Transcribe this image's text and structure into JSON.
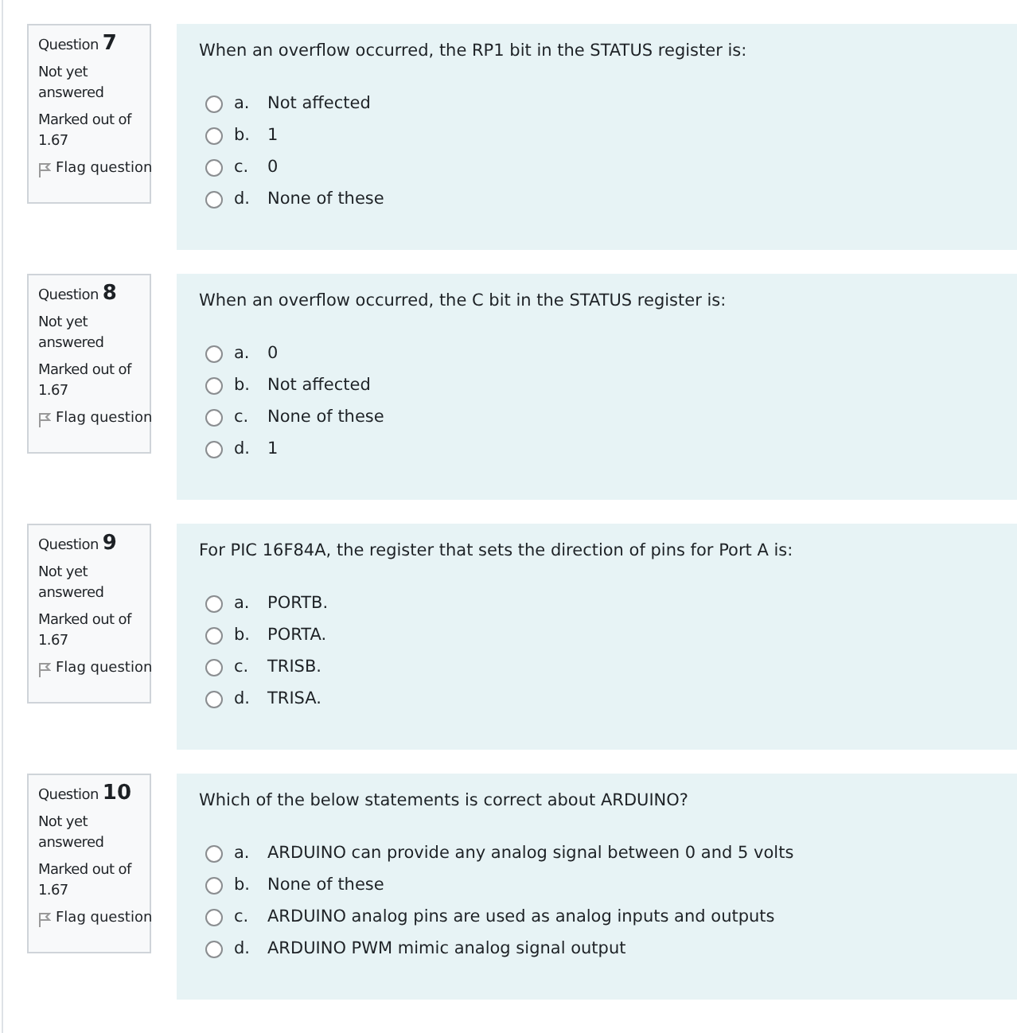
{
  "questions": [
    {
      "label": "Question",
      "number": "7",
      "status": "Not yet answered",
      "marks": "Marked out of 1.67",
      "flag": "Flag question",
      "text": "When an overflow occurred, the RP1 bit in the STATUS register is:",
      "options": [
        {
          "letter": "a.",
          "text": "Not affected",
          "selected": false
        },
        {
          "letter": "b.",
          "text": "1",
          "selected": false
        },
        {
          "letter": "c.",
          "text": "0",
          "selected": false
        },
        {
          "letter": "d.",
          "text": "None of these",
          "selected": false
        }
      ]
    },
    {
      "label": "Question",
      "number": "8",
      "status": "Not yet answered",
      "marks": "Marked out of 1.67",
      "flag": "Flag question",
      "text": "When an overflow occurred, the C bit in the STATUS register is:",
      "options": [
        {
          "letter": "a.",
          "text": "0",
          "selected": false
        },
        {
          "letter": "b.",
          "text": "Not affected",
          "selected": false
        },
        {
          "letter": "c.",
          "text": "None of these",
          "selected": false
        },
        {
          "letter": "d.",
          "text": "1",
          "selected": false
        }
      ]
    },
    {
      "label": "Question",
      "number": "9",
      "status": "Not yet answered",
      "marks": "Marked out of 1.67",
      "flag": "Flag question",
      "text": "For PIC 16F84A, the register that sets the direction of pins for Port A is:",
      "options": [
        {
          "letter": "a.",
          "text": "PORTB.",
          "selected": false
        },
        {
          "letter": "b.",
          "text": "PORTA.",
          "selected": false
        },
        {
          "letter": "c.",
          "text": "TRISB.",
          "selected": false
        },
        {
          "letter": "d.",
          "text": "TRISA.",
          "selected": false
        }
      ]
    },
    {
      "label": "Question",
      "number": "10",
      "status": "Not yet answered",
      "marks": "Marked out of 1.67",
      "flag": "Flag question",
      "text": "Which of the below statements is correct about ARDUINO?",
      "options": [
        {
          "letter": "a.",
          "text": "ARDUINO can provide any analog signal between 0 and 5 volts",
          "selected": false
        },
        {
          "letter": "b.",
          "text": "None of these",
          "selected": false
        },
        {
          "letter": "c.",
          "text": "ARDUINO analog pins are used as analog inputs and outputs",
          "selected": false
        },
        {
          "letter": "d.",
          "text": "ARDUINO PWM mimic analog signal output",
          "selected": false
        }
      ]
    }
  ]
}
